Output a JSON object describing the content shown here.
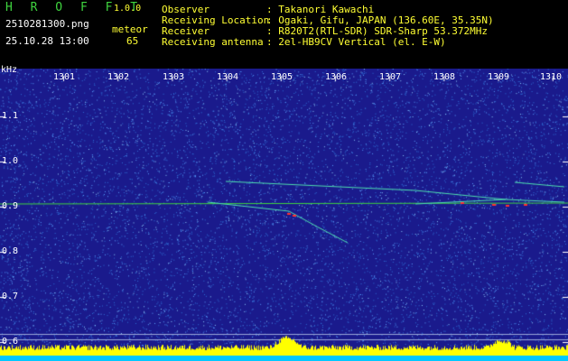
{
  "header": {
    "app_title": "H R O F F T",
    "version": "1.0.0",
    "filename": "2510281300.png",
    "datetime": "25.10.28 13:00",
    "meteor_label": "meteor",
    "meteor_count": "65",
    "info": [
      {
        "key": "Observer",
        "value": ": Takanori Kawachi"
      },
      {
        "key": "Receiving Location",
        "value": ": Ogaki, Gifu, JAPAN (136.60E, 35.35N)"
      },
      {
        "key": "Receiver",
        "value": ": R820T2(RTL-SDR) SDR-Sharp 53.372MHz"
      },
      {
        "key": "Receiving antenna",
        "value": ": 2el-HB9CV Vertical (el. E-W)"
      }
    ]
  },
  "spectrogram": {
    "unit": "kHz",
    "y_ticks": [
      "1.1",
      "1.0",
      "0.9",
      "0.8",
      "0.7",
      "0.6"
    ],
    "x_ticks": [
      "1301",
      "1302",
      "1303",
      "1304",
      "1305",
      "1306",
      "1307",
      "1308",
      "1309",
      "1310"
    ],
    "colors": {
      "background": "#1a1a8c",
      "noise": "#2f6fd6",
      "carrier": "#3fd43f",
      "echo": "#ff3030",
      "level": "#ffff00",
      "baseline": "#00c8ff"
    }
  }
}
